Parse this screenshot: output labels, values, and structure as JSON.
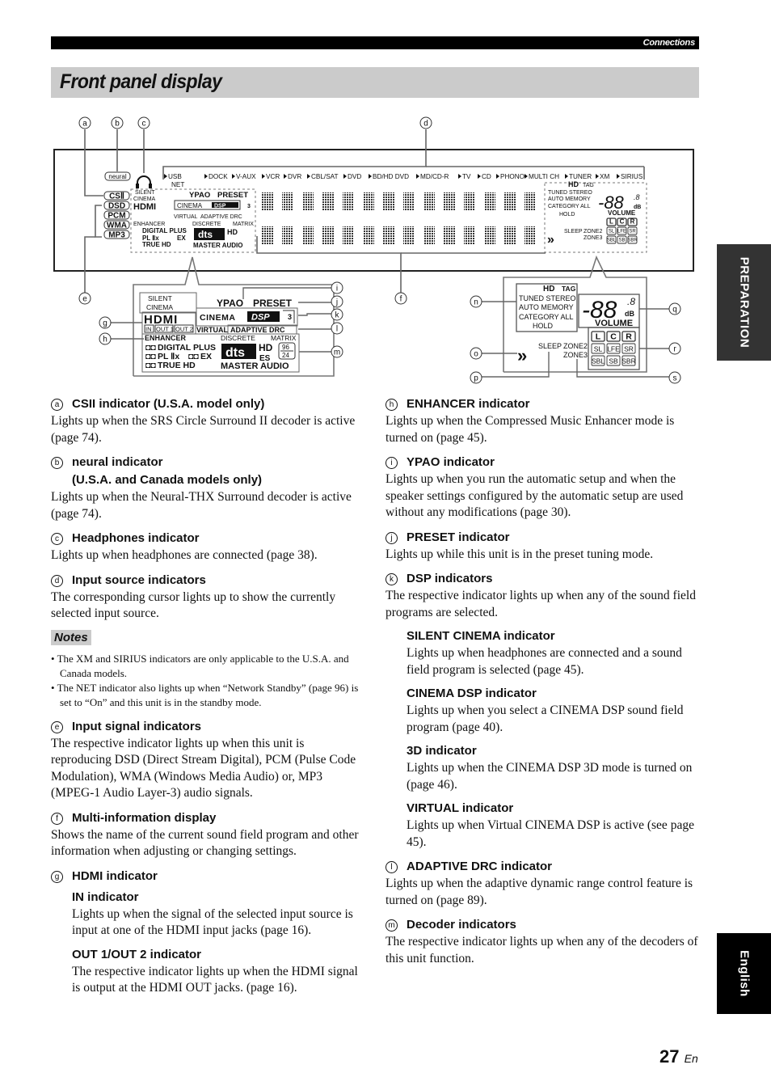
{
  "header": {
    "section": "Connections"
  },
  "page_title": "Front panel display",
  "side_tabs": {
    "preparation": "PREPARATION",
    "language": "English"
  },
  "page_number": {
    "num": "27",
    "suffix": "En"
  },
  "diagram": {
    "callouts": [
      "a",
      "b",
      "c",
      "d",
      "e",
      "f",
      "g",
      "h",
      "i",
      "j",
      "k",
      "l",
      "m",
      "n",
      "o",
      "p",
      "q",
      "r",
      "s"
    ],
    "input_sources": [
      "USB",
      "DOCK",
      "V-AUX",
      "VCR",
      "DVR",
      "CBL/SAT",
      "DVD",
      "BD/HD DVD",
      "MD/CD-R",
      "TV",
      "CD",
      "PHONO",
      "MULTI CH",
      "TUNER",
      "XM",
      "SIRIUS"
    ],
    "net_label": "NET",
    "neural": "neural",
    "signal_indicators": [
      "CSⅡ",
      "DSD",
      "PCM",
      "WMA",
      "MP3"
    ],
    "silent": "SILENT",
    "cinema": "CINEMA",
    "hdmi": "HDMI",
    "hdmi_ports": [
      "IN",
      "OUT 1",
      "OUT 2"
    ],
    "ypao": "YPAO",
    "preset": "PRESET",
    "cinema_dsp_cinema": "CINEMA",
    "cinema_dsp_dsp": "DSP",
    "three_d": "3",
    "virtual": "VIRTUAL",
    "adaptive_drc": "ADAPTIVE DRC",
    "enhancer": "ENHANCER",
    "discrete": "DISCRETE",
    "matrix": "MATRIX",
    "digital_plus": "DIGITAL PLUS",
    "pl2x": "PL Ⅱx",
    "ex": "EX",
    "true_hd": "TRUE HD",
    "dts": "dts",
    "hd": "HD",
    "es": "ES",
    "rate_top": "96",
    "rate_bot": "24",
    "master_audio": "MASTER AUDIO",
    "hd_tag_hd": "HD",
    "hd_tag_tag": "TAG",
    "tuner_lines": [
      "TUNED STEREO",
      "AUTO MEMORY",
      "CATEGORY ALL",
      "HOLD"
    ],
    "volume_digits": "-88",
    "volume_decimal": ".8",
    "db": "dB",
    "volume": "VOLUME",
    "sleep": "SLEEP",
    "zone2": "ZONE2",
    "zone3": "ZONE3",
    "speakers_row1": [
      "L",
      "C",
      "R"
    ],
    "speakers_row2": [
      "SL",
      "LFE",
      "SR"
    ],
    "speakers_row3": [
      "SBL",
      "SB",
      "SBR"
    ]
  },
  "left_column": [
    {
      "letter": "a",
      "title": "CSII indicator (U.S.A. model only)",
      "body": "Lights up when the SRS Circle Surround II decoder is active (page 74)."
    },
    {
      "letter": "b",
      "title": "neural indicator",
      "title2": "(U.S.A. and Canada models only)",
      "body": "Lights up when the Neural-THX Surround decoder is active (page 74)."
    },
    {
      "letter": "c",
      "title": "Headphones indicator",
      "body": "Lights up when headphones are connected (page 38)."
    },
    {
      "letter": "d",
      "title": "Input source indicators",
      "body": "The corresponding cursor lights up to show the currently selected input source."
    }
  ],
  "notes": {
    "title": "Notes",
    "items": [
      "The XM and SIRIUS indicators are only applicable to the U.S.A. and Canada models.",
      "The NET indicator also lights up when “Network Standby” (page 96) is set to “On” and this unit is in the standby mode."
    ]
  },
  "left_column_2": [
    {
      "letter": "e",
      "title": "Input signal indicators",
      "body": "The respective indicator lights up when this unit is reproducing DSD (Direct Stream Digital), PCM (Pulse Code Modulation), WMA (Windows Media Audio) or, MP3 (MPEG-1 Audio Layer-3) audio signals."
    },
    {
      "letter": "f",
      "title": "Multi-information display",
      "body": "Shows the name of the current sound field program and other information when adjusting or changing settings."
    }
  ],
  "hdmi_item": {
    "letter": "g",
    "title": "HDMI indicator",
    "subs": [
      {
        "title": "IN indicator",
        "body": "Lights up when the signal of the selected input source is input at one of the HDMI input jacks (page 16)."
      },
      {
        "title": "OUT 1/OUT 2 indicator",
        "body": "The respective indicator lights up when the HDMI signal is output at the HDMI OUT jacks. (page 16)."
      }
    ]
  },
  "right_column": [
    {
      "letter": "h",
      "title": "ENHANCER indicator",
      "body": "Lights up when the Compressed Music Enhancer mode is turned on (page 45)."
    },
    {
      "letter": "i",
      "title": "YPAO indicator",
      "body": "Lights up when you run the automatic setup and when the speaker settings configured by the automatic setup are used without any modifications (page 30)."
    },
    {
      "letter": "j",
      "title": "PRESET indicator",
      "body": "Lights up while this unit is in the preset tuning mode."
    }
  ],
  "dsp_item": {
    "letter": "k",
    "title": "DSP indicators",
    "body": "The respective indicator lights up when any of the sound field programs are selected.",
    "subs": [
      {
        "title": "SILENT CINEMA indicator",
        "body": "Lights up when headphones are connected and a sound field program is selected (page 45)."
      },
      {
        "title": "CINEMA DSP indicator",
        "body": "Lights up when you select a CINEMA DSP sound field program (page 40)."
      },
      {
        "title": "3D indicator",
        "body": "Lights up when the CINEMA DSP 3D mode is turned on (page 46)."
      },
      {
        "title": "VIRTUAL indicator",
        "body": "Lights up when Virtual CINEMA DSP is active (see page 45)."
      }
    ]
  },
  "right_column_2": [
    {
      "letter": "l",
      "title": "ADAPTIVE DRC indicator",
      "body": "Lights up when the adaptive dynamic range control feature is turned on (page 89)."
    },
    {
      "letter": "m",
      "title": "Decoder indicators",
      "body": "The respective indicator lights up when any of the decoders of this unit function."
    }
  ]
}
